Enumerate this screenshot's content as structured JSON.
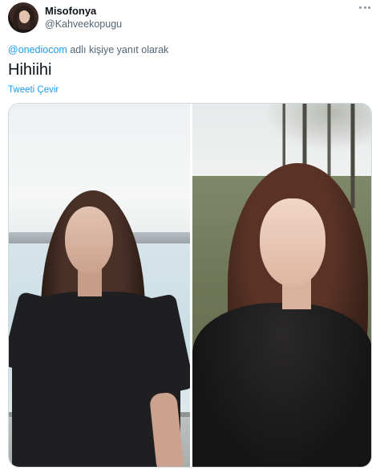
{
  "user": {
    "display_name": "Misofonya",
    "handle": "@Kahveekopugu"
  },
  "tweet": {
    "reply_mention": "@onediocom",
    "reply_suffix": " adlı kişiye yanıt olarak",
    "text": "Hihiihi",
    "translate_label": "Tweeti Çevir"
  },
  "icons": {
    "more": "more-horizontal-icon"
  },
  "colors": {
    "link": "#1d9bf0",
    "secondary_text": "#536471",
    "primary_text": "#0f1419"
  }
}
